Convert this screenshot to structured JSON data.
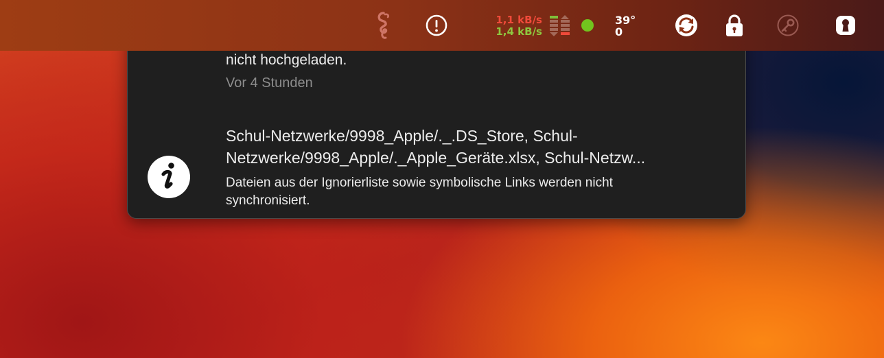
{
  "menubar": {
    "items": [
      {
        "name": "seahorse-app",
        "icon": "seahorse-icon"
      },
      {
        "name": "alert-status",
        "icon": "exclamation-circle-icon"
      },
      {
        "name": "network-monitor",
        "icon": "network-bars-icon"
      },
      {
        "name": "status-dot",
        "icon": "green-dot-icon"
      },
      {
        "name": "sync-app",
        "icon": "sync-arrows-icon"
      },
      {
        "name": "lock-app",
        "icon": "padlock-icon"
      },
      {
        "name": "key-app",
        "icon": "key-icon"
      },
      {
        "name": "keyhole-app",
        "icon": "keyhole-shield-icon"
      }
    ],
    "network": {
      "upload": "1,1 kB/s",
      "download": "1,4 kB/s",
      "upload_color": "#f04a3a",
      "download_color": "#8ec63f"
    },
    "sensor": {
      "temperature": "39°",
      "fan": "0"
    },
    "status_dot_color": "#72c31e"
  },
  "panel": {
    "notifications": [
      {
        "icon": "sync-status-icon",
        "message": "nicht hochgeladen.",
        "time": "Vor 4 Stunden"
      },
      {
        "icon": "info-icon",
        "title_line1": "Schul-Netzwerke/9998_Apple/._.DS_Store, Schul-",
        "title_line2": "Netzwerke/9998_Apple/._Apple_Geräte.xlsx, Schul-Netzw...",
        "detail_line1": "Dateien aus der Ignorierliste sowie symbolische Links werden nicht",
        "detail_line2": "synchronisiert."
      }
    ]
  }
}
